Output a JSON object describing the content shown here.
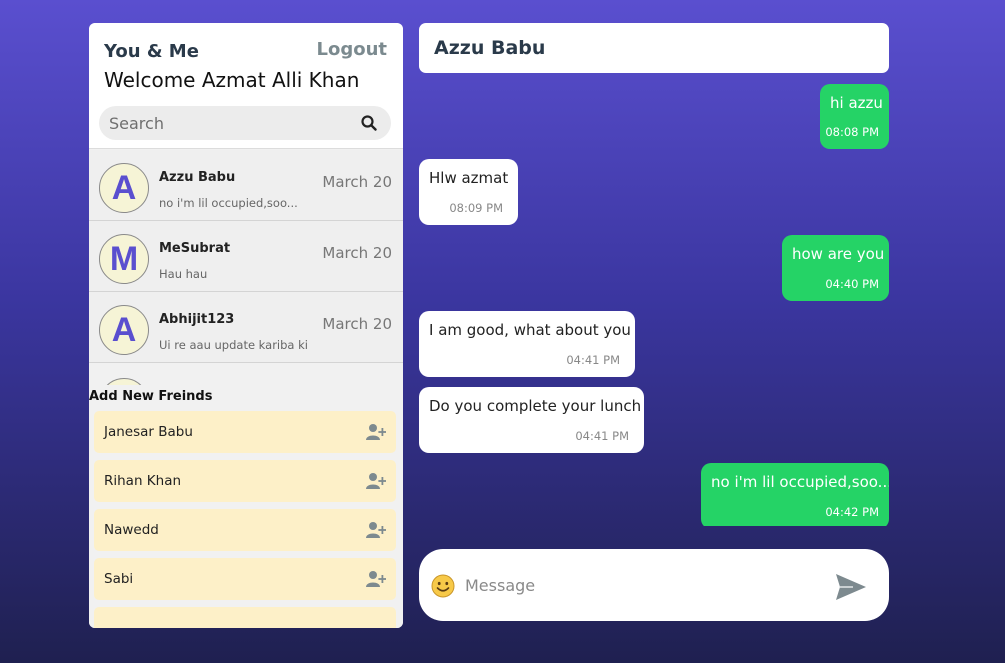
{
  "sidebar": {
    "brand": "You & Me",
    "logout_label": "Logout",
    "welcome": "Welcome Azmat Alli Khan",
    "search": {
      "placeholder": "Search",
      "value": ""
    },
    "chats": [
      {
        "initial": "A",
        "name": "Azzu Babu",
        "preview": "no i'm lil occupied,soo...",
        "date": "March 20"
      },
      {
        "initial": "M",
        "name": "MeSubrat",
        "preview": "Hau hau",
        "date": "March 20"
      },
      {
        "initial": "A",
        "name": "Abhijit123",
        "preview": "Ui re aau update kariba ki",
        "date": "March 20"
      }
    ],
    "add_friends": {
      "title": "Add New Freinds",
      "friends": [
        {
          "name": "Janesar Babu",
          "icon": "add-user-icon"
        },
        {
          "name": "Rihan Khan",
          "icon": "add-user-icon"
        },
        {
          "name": "Nawedd",
          "icon": "add-user-icon"
        },
        {
          "name": "Sabi",
          "icon": "add-user-icon"
        }
      ]
    }
  },
  "chat": {
    "title": "Azzu Babu",
    "messages": [
      {
        "direction": "sent",
        "text": "hi azzu",
        "time": "08:08 PM"
      },
      {
        "direction": "received",
        "text": "Hlw azmat",
        "time": "08:09 PM"
      },
      {
        "direction": "sent",
        "text": "how are you",
        "time": "04:40 PM"
      },
      {
        "direction": "received",
        "text": "I am good, what about you",
        "time": "04:41 PM"
      },
      {
        "direction": "received",
        "text": "Do you complete your lunch",
        "time": "04:41 PM"
      },
      {
        "direction": "sent",
        "text": "no i'm lil occupied,soo...",
        "time": "04:42 PM"
      }
    ],
    "composer": {
      "placeholder": "Message",
      "value": "",
      "emoji_icon": "smiley-icon",
      "send_icon": "send-icon"
    }
  },
  "colors": {
    "sent_bubble": "#25d366",
    "received_bubble": "#ffffff",
    "avatar_letter": "#5a4fcf",
    "friend_card": "#fdf0c8",
    "background_top": "#5a4fcf",
    "background_bottom": "#1f2050"
  }
}
